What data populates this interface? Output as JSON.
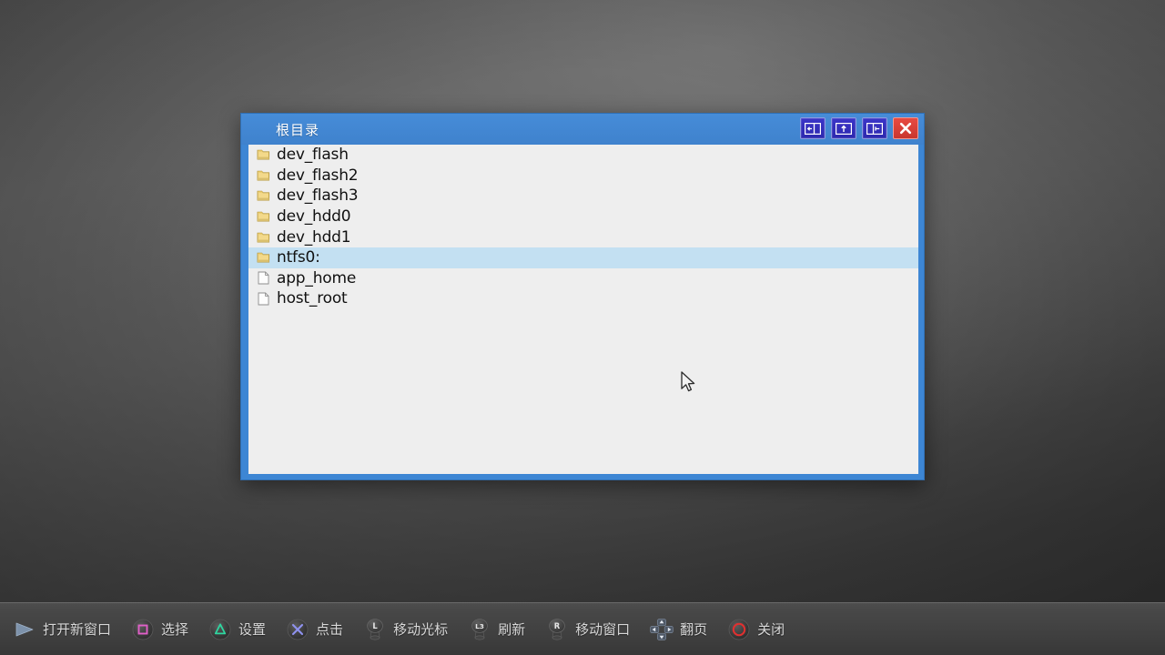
{
  "window": {
    "title": "根目录",
    "titlebar_buttons": [
      {
        "name": "split-left-button",
        "icon": "window-split-left-icon"
      },
      {
        "name": "maximize-button",
        "icon": "window-up-icon"
      },
      {
        "name": "split-right-button",
        "icon": "window-split-right-icon"
      },
      {
        "name": "close-button",
        "icon": "close-x-icon"
      }
    ],
    "files": [
      {
        "label": "dev_flash",
        "type": "folder",
        "selected": false
      },
      {
        "label": "dev_flash2",
        "type": "folder",
        "selected": false
      },
      {
        "label": "dev_flash3",
        "type": "folder",
        "selected": false
      },
      {
        "label": "dev_hdd0",
        "type": "folder",
        "selected": false
      },
      {
        "label": "dev_hdd1",
        "type": "folder",
        "selected": false
      },
      {
        "label": "ntfs0:",
        "type": "folder",
        "selected": true
      },
      {
        "label": "app_home",
        "type": "file",
        "selected": false
      },
      {
        "label": "host_root",
        "type": "file",
        "selected": false
      }
    ]
  },
  "taskbar": {
    "hints": [
      {
        "icon": "play-triangle-icon",
        "label": "打开新窗口"
      },
      {
        "icon": "square-button-icon",
        "label": "选择"
      },
      {
        "icon": "triangle-button-icon",
        "label": "设置"
      },
      {
        "icon": "cross-button-icon",
        "label": "点击"
      },
      {
        "icon": "left-stick-icon",
        "label": "移动光标"
      },
      {
        "icon": "l3-stick-icon",
        "label": "刷新"
      },
      {
        "icon": "right-stick-icon",
        "label": "移动窗口"
      },
      {
        "icon": "dpad-icon",
        "label": "翻页"
      },
      {
        "icon": "circle-button-icon",
        "label": "关闭"
      }
    ]
  },
  "colors": {
    "window_frame": "#3d86d4",
    "titlebar": "#468cd8",
    "list_background": "#eeeeee",
    "selection": "#c3e0f2",
    "close_red": "#e84a42",
    "button_blue": "#3b35c8",
    "ps_square_pink": "#e060c8",
    "ps_triangle_green": "#2fd6a0",
    "ps_cross_blue": "#8f92f0",
    "ps_circle_red": "#e03030"
  }
}
